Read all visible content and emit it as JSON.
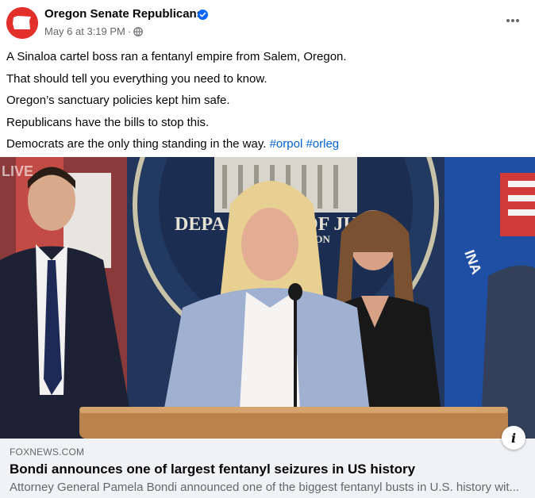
{
  "post": {
    "author": "Oregon Senate Republicans",
    "timestamp": "May 6 at 3:19 PM",
    "separator": "·",
    "privacy_icon": "globe-icon",
    "verified_icon": "verified-badge-icon",
    "menu_icon": "more-options-icon",
    "lines": [
      "A Sinaloa cartel boss ran a fentanyl empire from Salem, Oregon.",
      "That should tell you everything you need to know.",
      "Oregon’s sanctuary policies kept him safe.",
      "Republicans have the bills to stop this."
    ],
    "last_line_text": "Democrats are the only thing standing in the way. ",
    "hashtags": [
      "#orpol",
      "#orleg"
    ]
  },
  "media": {
    "live_badge": "LIVE",
    "seal_text_left": "DEPA",
    "seal_text_right": "OF JU",
    "seal_text_sub": "TON",
    "flag_text": "INA"
  },
  "link": {
    "domain": "FOXNEWS.COM",
    "headline": "Bondi announces one of largest fentanyl seizures in US history",
    "description": "Attorney General Pamela Bondi announced one of the biggest fentanyl busts in U.S. history wit...",
    "info_label": "i"
  },
  "colors": {
    "brand_red": "#e4302b",
    "link_blue": "#0064d1",
    "verified_blue": "#0866ff",
    "secondary_text": "#65676b",
    "card_bg": "#f0f2f5"
  }
}
